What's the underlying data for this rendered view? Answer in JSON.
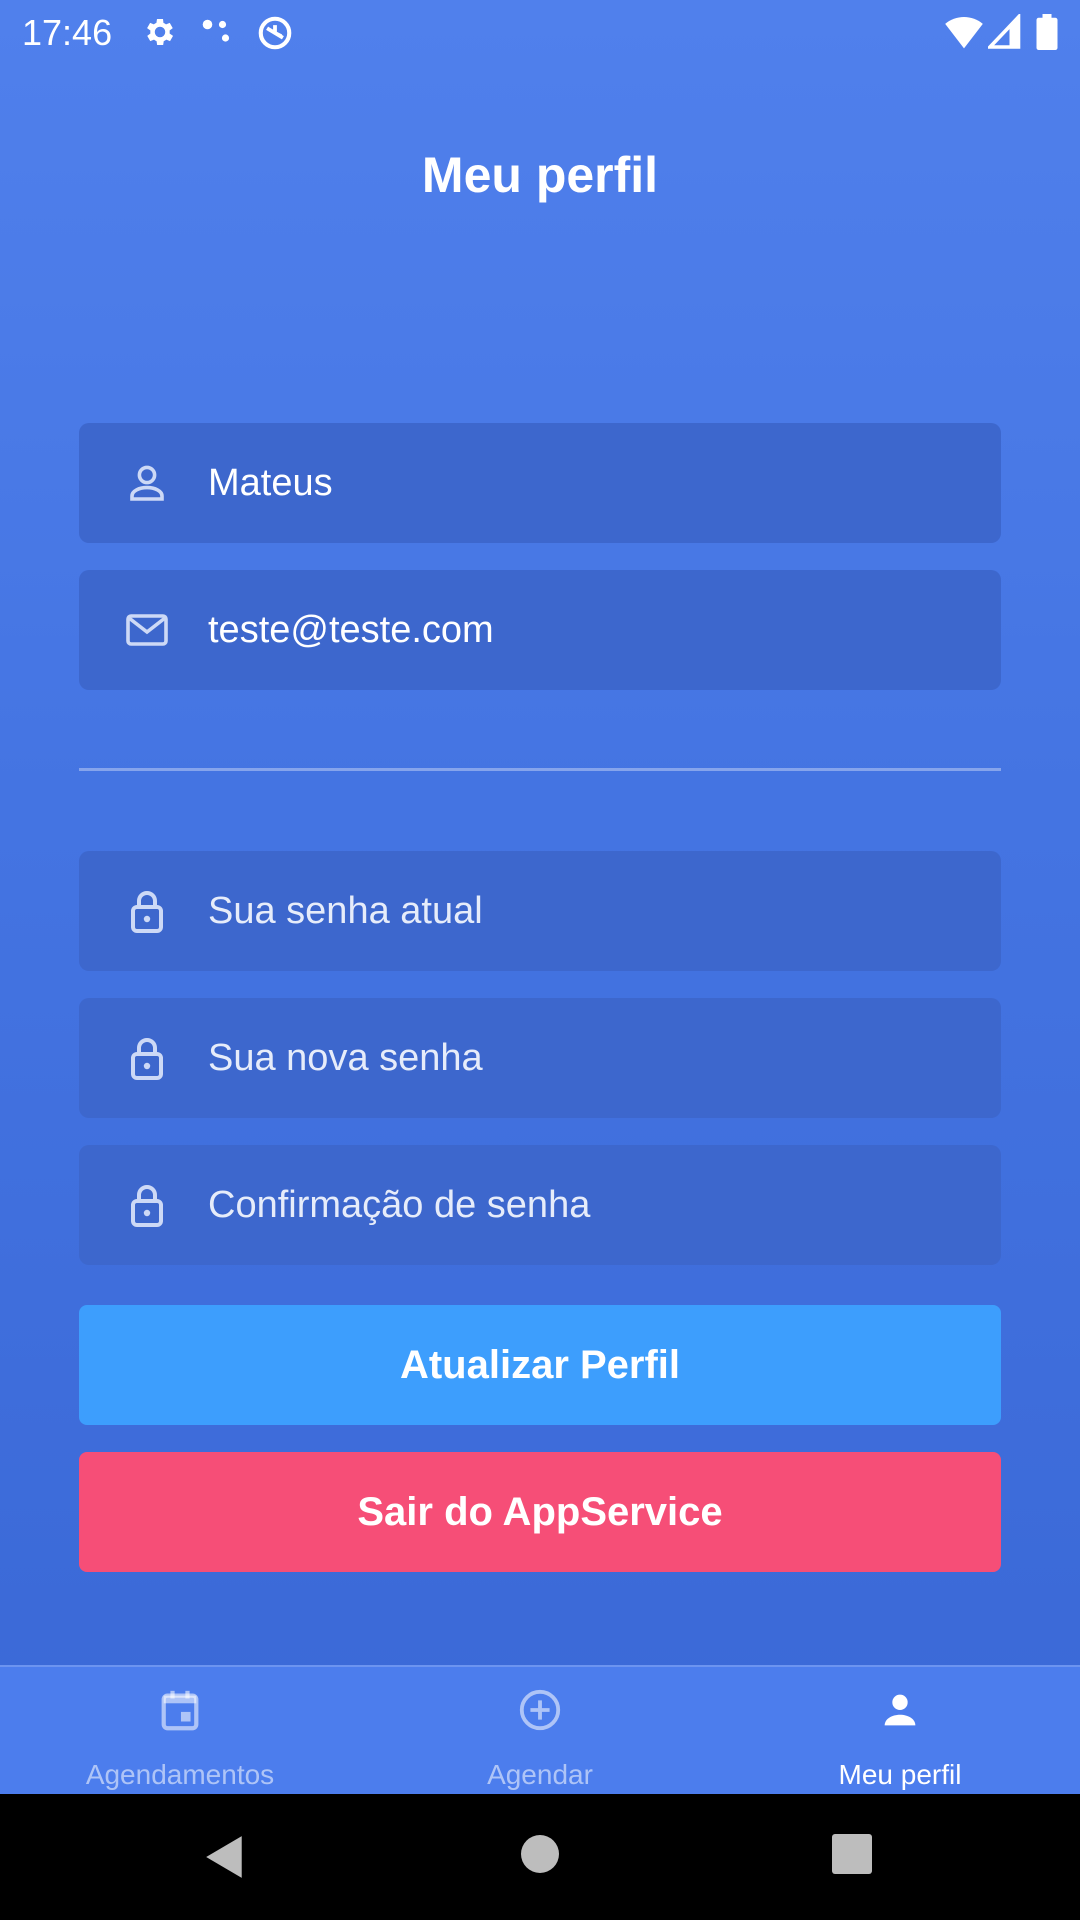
{
  "status_bar": {
    "time": "17:46",
    "icons": [
      "gear-icon",
      "dots-icon",
      "sync-icon",
      "wifi-icon",
      "signal-icon",
      "battery-icon"
    ]
  },
  "header": {
    "title": "Meu perfil"
  },
  "profile_form": {
    "name": {
      "value": "Mateus",
      "icon": "user-icon"
    },
    "email": {
      "value": "teste@teste.com",
      "icon": "mail-icon"
    },
    "current_password": {
      "placeholder": "Sua senha atual",
      "icon": "lock-icon"
    },
    "new_password": {
      "placeholder": "Sua nova senha",
      "icon": "lock-icon"
    },
    "confirm_password": {
      "placeholder": "Confirmação de senha",
      "icon": "lock-icon"
    }
  },
  "buttons": {
    "update_label": "Atualizar Perfil",
    "logout_label": "Sair do AppService"
  },
  "tabbar": {
    "tabs": [
      {
        "label": "Agendamentos",
        "icon": "calendar-icon",
        "active": false
      },
      {
        "label": "Agendar",
        "icon": "plus-circle-icon",
        "active": false
      },
      {
        "label": "Meu perfil",
        "icon": "user-icon",
        "active": true
      }
    ]
  },
  "colors": {
    "background": "#4474e2",
    "field_background": "#3d67cd",
    "update_button": "#3d9efd",
    "logout_button": "#f64e77",
    "tabbar": "#4c7ded"
  },
  "system_nav": [
    "back-icon",
    "home-icon",
    "recents-icon"
  ]
}
